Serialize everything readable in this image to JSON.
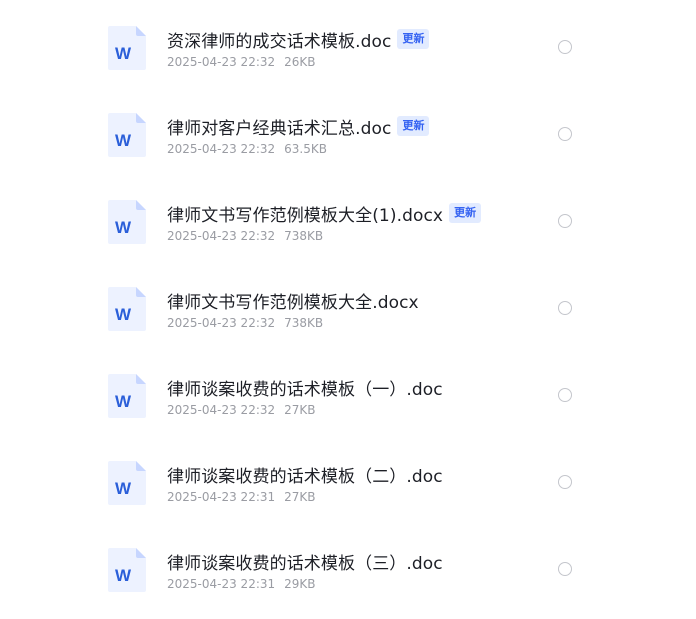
{
  "files": [
    {
      "name": "资深律师的成交话术模板.doc",
      "badge": "更新",
      "date": "2025-04-23 22:32",
      "size": "26KB",
      "icon": "word-doc-icon"
    },
    {
      "name": "律师对客户经典话术汇总.doc",
      "badge": "更新",
      "date": "2025-04-23 22:32",
      "size": "63.5KB",
      "icon": "word-doc-icon"
    },
    {
      "name": "律师文书写作范例模板大全(1).docx",
      "badge": "更新",
      "date": "2025-04-23 22:32",
      "size": "738KB",
      "icon": "word-doc-icon"
    },
    {
      "name": "律师文书写作范例模板大全.docx",
      "badge": "",
      "date": "2025-04-23 22:32",
      "size": "738KB",
      "icon": "word-doc-icon"
    },
    {
      "name": "律师谈案收费的话术模板（一）.doc",
      "badge": "",
      "date": "2025-04-23 22:32",
      "size": "27KB",
      "icon": "word-doc-icon"
    },
    {
      "name": "律师谈案收费的话术模板（二）.doc",
      "badge": "",
      "date": "2025-04-23 22:31",
      "size": "27KB",
      "icon": "word-doc-icon"
    },
    {
      "name": "律师谈案收费的话术模板（三）.doc",
      "badge": "",
      "date": "2025-04-23 22:31",
      "size": "29KB",
      "icon": "word-doc-icon"
    }
  ],
  "icon_letter": "W",
  "colors": {
    "badge_bg": "#e2ebff",
    "badge_text": "#3563f2",
    "icon_blue": "#2b5fd9",
    "icon_page": "#edf2ff",
    "title_text": "#1d1f26",
    "meta_text": "#9a9ca3"
  }
}
